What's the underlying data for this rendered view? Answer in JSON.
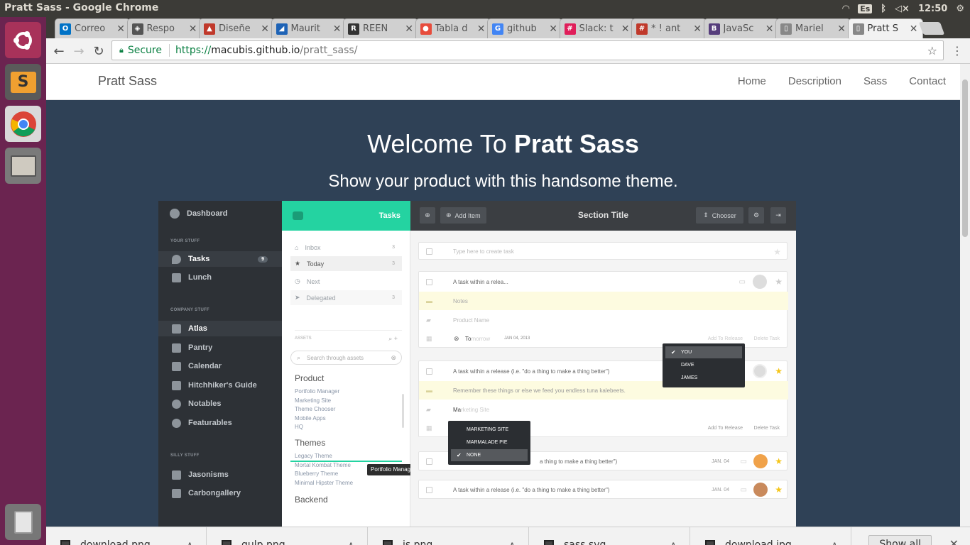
{
  "window": {
    "title": "Pratt Sass - Google Chrome"
  },
  "tray": {
    "keyboard": "Es",
    "clock": "12:50"
  },
  "tabs": [
    {
      "label": "Correo",
      "fav": "O",
      "color": "#0072c6"
    },
    {
      "label": "Respo",
      "fav": "◈",
      "color": "#555"
    },
    {
      "label": "Diseñe",
      "fav": "▲",
      "color": "#c0392b"
    },
    {
      "label": "Maurit",
      "fav": "◢",
      "color": "#1e63b6"
    },
    {
      "label": "REEN",
      "fav": "R",
      "color": "#333"
    },
    {
      "label": "Tabla d",
      "fav": "●",
      "color": "#e74c3c"
    },
    {
      "label": "github",
      "fav": "G",
      "color": "#4285f4"
    },
    {
      "label": "Slack: t",
      "fav": "#",
      "color": "#e01e5a"
    },
    {
      "label": "* ! ant",
      "fav": "#",
      "color": "#c0392b"
    },
    {
      "label": "JavaSc",
      "fav": "B",
      "color": "#563d7c"
    },
    {
      "label": "Mariel",
      "fav": "▯",
      "color": "#888"
    },
    {
      "label": "Pratt S",
      "fav": "▯",
      "color": "#888"
    }
  ],
  "address": {
    "secure": "Secure",
    "scheme": "https://",
    "host": "macubis.github.io",
    "path": "/pratt_sass/"
  },
  "site": {
    "brand": "Pratt Sass",
    "nav": [
      "Home",
      "Description",
      "Sass",
      "Contact"
    ],
    "hero_welcome": "Welcome To ",
    "hero_brand": "Pratt Sass",
    "hero_sub": "Show your product with this handsome theme."
  },
  "app": {
    "sidebar": {
      "dashboard": "Dashboard",
      "sec1": "YOUR STUFF",
      "tasks": "Tasks",
      "tasks_count": "9",
      "lunch": "Lunch",
      "sec2": "COMPANY STUFF",
      "items2": [
        "Atlas",
        "Pantry",
        "Calendar",
        "Hitchhiker's Guide",
        "Notables",
        "Featurables"
      ],
      "sec3": "SILLY STUFF",
      "items3": [
        "Jasonisms",
        "Carbongallery"
      ]
    },
    "middle": {
      "header": "Tasks",
      "inbox": "Inbox",
      "inbox_count": "3",
      "today": "Today",
      "today_count": "3",
      "next": "Next",
      "delegated": "Delegated",
      "delegated_count": "3",
      "assets": "ASSETS",
      "search_placeholder": "Search through assets",
      "product": "Product",
      "product_items": [
        "Portfolio Manager",
        "Marketing Site",
        "Theme Chooser",
        "Mobile Apps",
        "HQ"
      ],
      "themes": "Themes",
      "theme_items": [
        "Legacy Theme",
        "Mortal Kombat Theme",
        "Blueberry Theme",
        "Minimal Hipster Theme"
      ],
      "backend": "Backend",
      "tooltip": "Portfolio Manager"
    },
    "main": {
      "add_item": "Add Item",
      "section_title": "Section Title",
      "chooser": "Chooser",
      "create_placeholder": "Type here to create task",
      "task1": "A task within a relea...",
      "notes": "Notes",
      "product_name": "Product Name",
      "tomorrow_typed": "To",
      "tomorrow_hint": "morrow",
      "date1": "JAN 04, 2013",
      "add_to_release": "Add To Release",
      "delete_task": "Delete Task",
      "task2": "A task within a release (i.e. \"do a thing to make a thing better\")",
      "note2": "Remember these things or else we feed you endless tuna kalebeets.",
      "mkt_typed": "Ma",
      "mkt_hint": "rketing Site",
      "task3": "a thing to make a thing better\")",
      "task4": "A task within a release (i.e. \"do a thing to make a thing better\")",
      "date_short": "JAN. 04",
      "assign_options": [
        "YOU",
        "DAVE",
        "JAMES"
      ],
      "project_options": [
        "MARKETING SITE",
        "MARMALADE PIE",
        "NONE"
      ]
    }
  },
  "downloads": [
    "download.png",
    "gulp.png",
    "js.png",
    "sass.svg",
    "download.jpg"
  ],
  "show_all": "Show all",
  "colors": {
    "accent": "#24d3a1",
    "hero_bg": "#2f4156",
    "launcher": "#6b2450",
    "star": "#f5c518"
  }
}
